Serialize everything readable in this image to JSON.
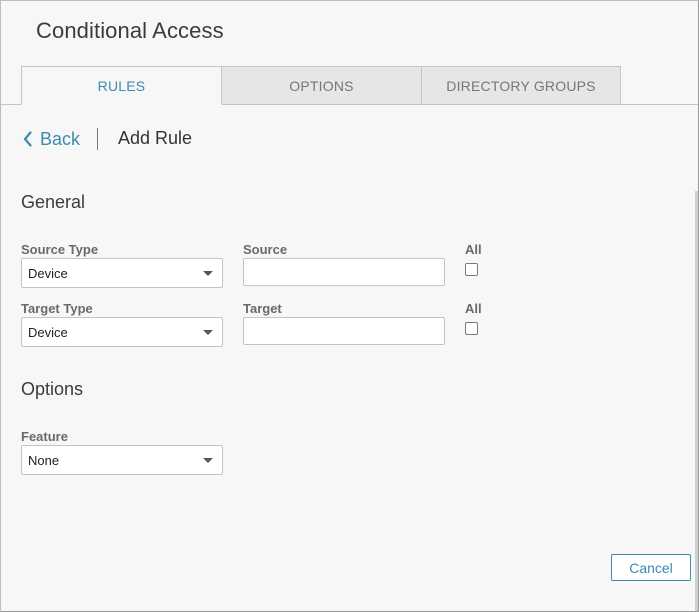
{
  "header": {
    "title": "Conditional Access"
  },
  "tabs": [
    {
      "label": "RULES",
      "active": true
    },
    {
      "label": "OPTIONS",
      "active": false
    },
    {
      "label": "DIRECTORY GROUPS",
      "active": false
    }
  ],
  "nav": {
    "back_label": "Back",
    "page_title": "Add Rule"
  },
  "general": {
    "heading": "General",
    "source_type": {
      "label": "Source Type",
      "value": "Device"
    },
    "source": {
      "label": "Source",
      "value": ""
    },
    "source_all": {
      "label": "All",
      "checked": false
    },
    "target_type": {
      "label": "Target Type",
      "value": "Device"
    },
    "target": {
      "label": "Target",
      "value": ""
    },
    "target_all": {
      "label": "All",
      "checked": false
    }
  },
  "options": {
    "heading": "Options",
    "feature": {
      "label": "Feature",
      "value": "None"
    }
  },
  "footer": {
    "cancel_label": "Cancel"
  },
  "colors": {
    "accent": "#3d8bae",
    "tab_inactive_bg": "#e6e6e6",
    "panel_bg": "#f7f7f7"
  }
}
